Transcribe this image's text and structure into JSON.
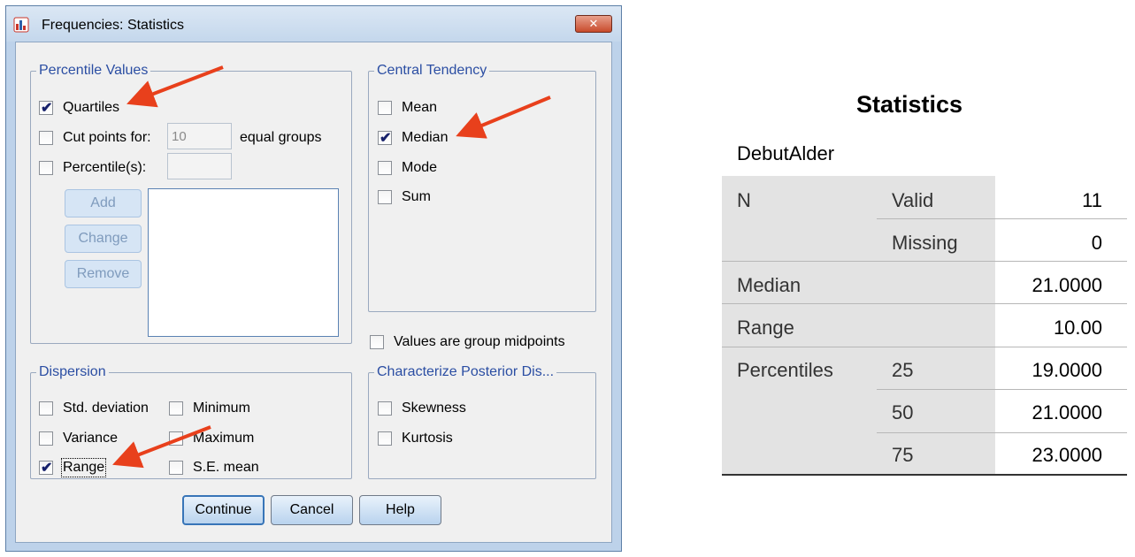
{
  "dialog": {
    "title": "Frequencies: Statistics",
    "close_label": "✕",
    "percentile_values": {
      "legend": "Percentile Values",
      "quartiles": {
        "label": "Quartiles",
        "checked": true
      },
      "cut_points": {
        "label": "Cut points for:",
        "value": "10",
        "suffix": "equal groups",
        "checked": false
      },
      "percentiles": {
        "label": "Percentile(s):",
        "value": "",
        "checked": false
      },
      "add_label": "Add",
      "change_label": "Change",
      "remove_label": "Remove"
    },
    "central_tendency": {
      "legend": "Central Tendency",
      "mean": {
        "label": "Mean",
        "checked": false
      },
      "median": {
        "label": "Median",
        "checked": true
      },
      "mode": {
        "label": "Mode",
        "checked": false
      },
      "sum": {
        "label": "Sum",
        "checked": false
      }
    },
    "group_midpoints": {
      "label": "Values are group midpoints",
      "checked": false
    },
    "dispersion": {
      "legend": "Dispersion",
      "std_deviation": {
        "label": "Std. deviation",
        "checked": false
      },
      "minimum": {
        "label": "Minimum",
        "checked": false
      },
      "variance": {
        "label": "Variance",
        "checked": false
      },
      "maximum": {
        "label": "Maximum",
        "checked": false
      },
      "range": {
        "label": "Range",
        "checked": true
      },
      "se_mean": {
        "label": "S.E. mean",
        "checked": false
      }
    },
    "posterior": {
      "legend": "Characterize Posterior Dis...",
      "skewness": {
        "label": "Skewness",
        "checked": false
      },
      "kurtosis": {
        "label": "Kurtosis",
        "checked": false
      }
    },
    "buttons": {
      "continue": "Continue",
      "cancel": "Cancel",
      "help": "Help"
    },
    "check_glyph": "✔"
  },
  "statistics": {
    "title": "Statistics",
    "variable": "DebutAlder",
    "rows": {
      "n_label": "N",
      "valid_label": "Valid",
      "valid_value": "11",
      "missing_label": "Missing",
      "missing_value": "0",
      "median_label": "Median",
      "median_value": "21.0000",
      "range_label": "Range",
      "range_value": "10.00",
      "percentiles_label": "Percentiles",
      "p25_label": "25",
      "p25_value": "19.0000",
      "p50_label": "50",
      "p50_value": "21.0000",
      "p75_label": "75",
      "p75_value": "23.0000"
    }
  },
  "colors": {
    "arrow": "#e8401c",
    "legend": "#2b4ea3",
    "dialog_frame": "#bdd2ea"
  }
}
